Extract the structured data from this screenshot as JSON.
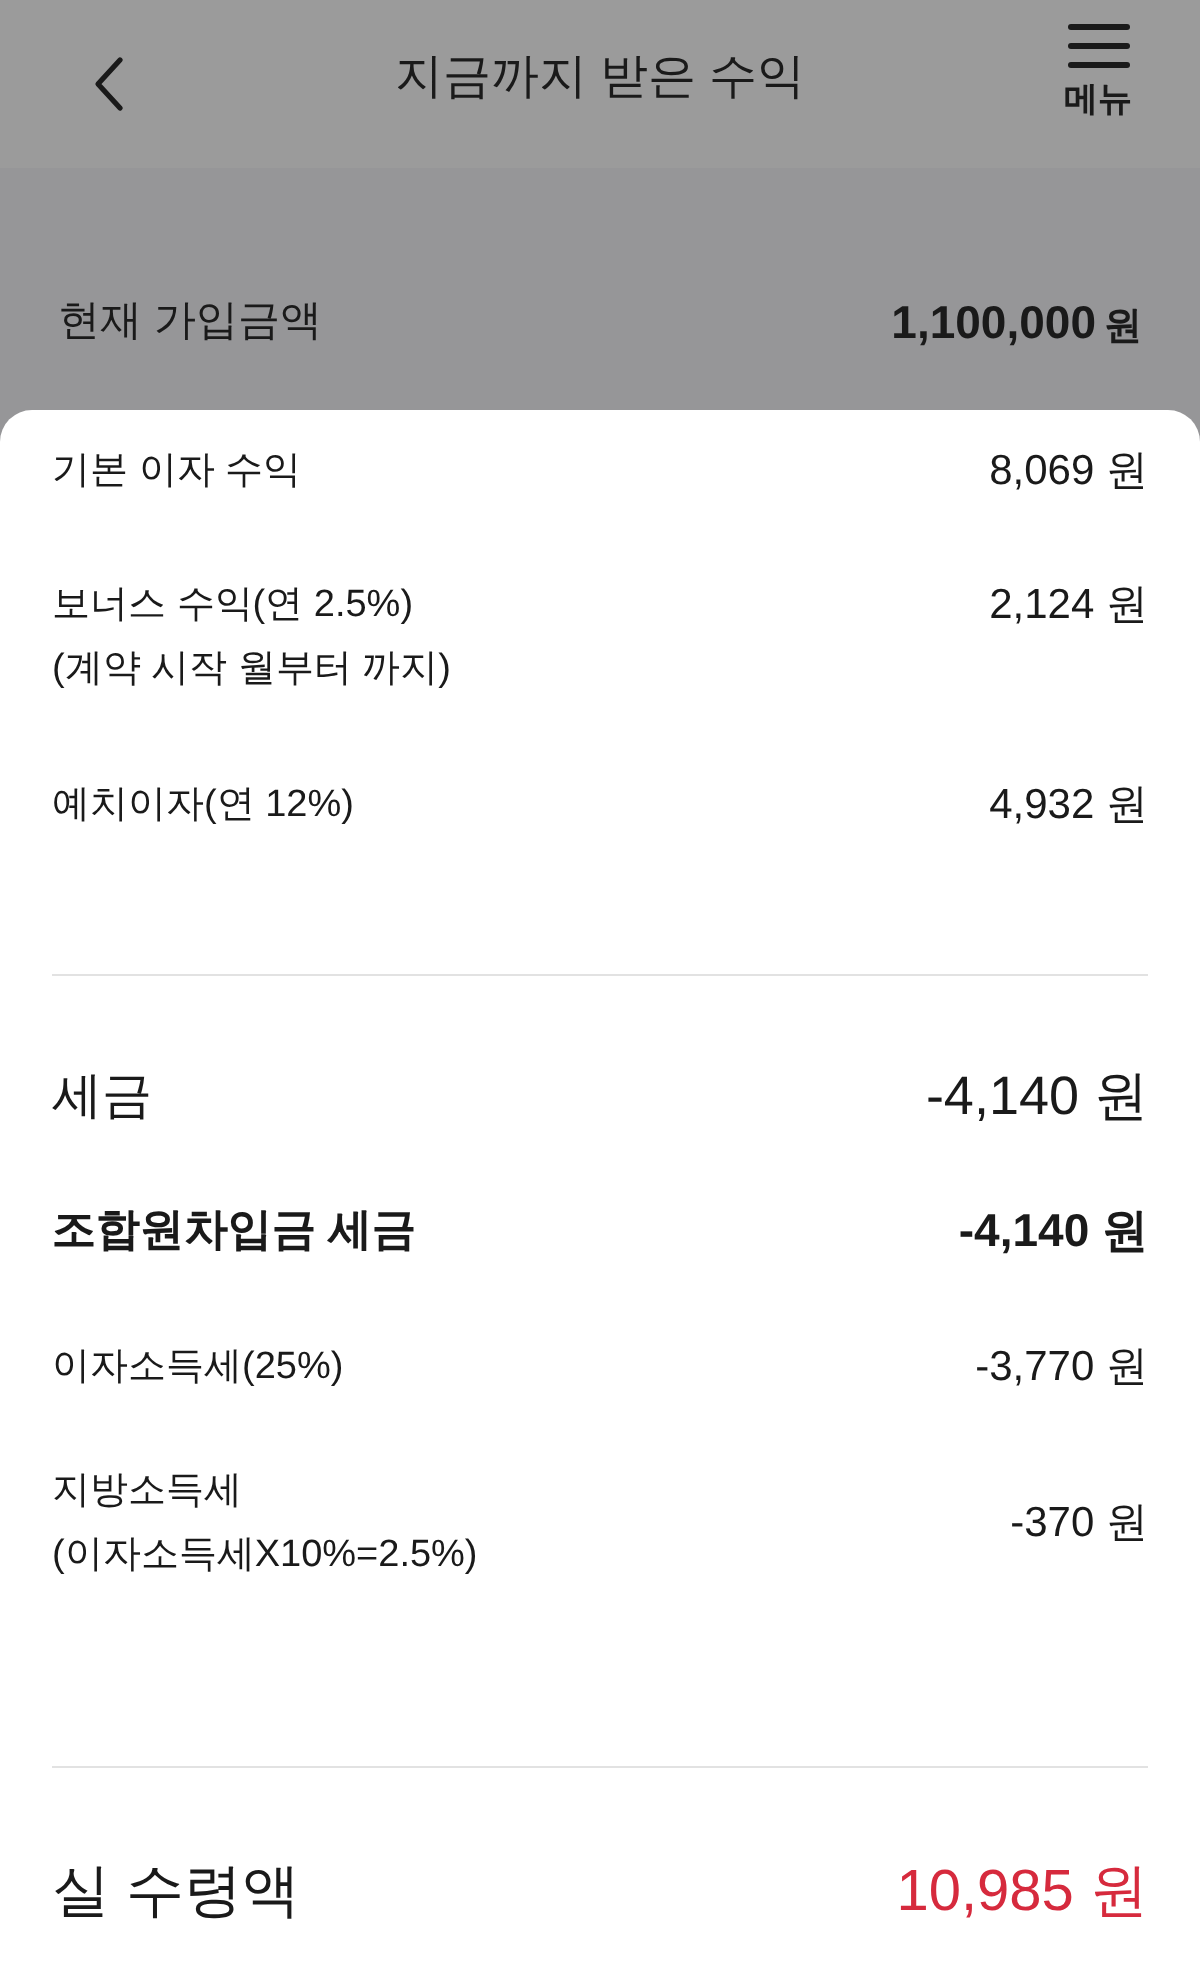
{
  "header": {
    "title": "지금까지 받은 수익",
    "menu_label": "메뉴"
  },
  "current_amount": {
    "label": "현재 가입금액",
    "value": "1,100,000",
    "unit": "원"
  },
  "income_rows": [
    {
      "label": "기본 이자 수익",
      "value": "8,069 원"
    },
    {
      "label": "보너스 수익(연 2.5%)",
      "note": "(계약 시작 월부터 까지)",
      "value": "2,124 원"
    },
    {
      "label": "예치이자(연 12%)",
      "value": "4,932 원"
    }
  ],
  "tax": {
    "label": "세금",
    "value": "-4,140 원"
  },
  "tax_rows": [
    {
      "kind": "subtotal",
      "label": "조합원차입금 세금",
      "value": "-4,140 원"
    },
    {
      "kind": "item",
      "label": "이자소득세(25%)",
      "value": "-3,770 원"
    },
    {
      "kind": "item",
      "label": "지방소득세",
      "note": "(이자소득세X10%=2.5%)",
      "value": "-370 원"
    }
  ],
  "net": {
    "label": "실 수령액",
    "value": "10,985 원",
    "color": "#d62a3d"
  }
}
